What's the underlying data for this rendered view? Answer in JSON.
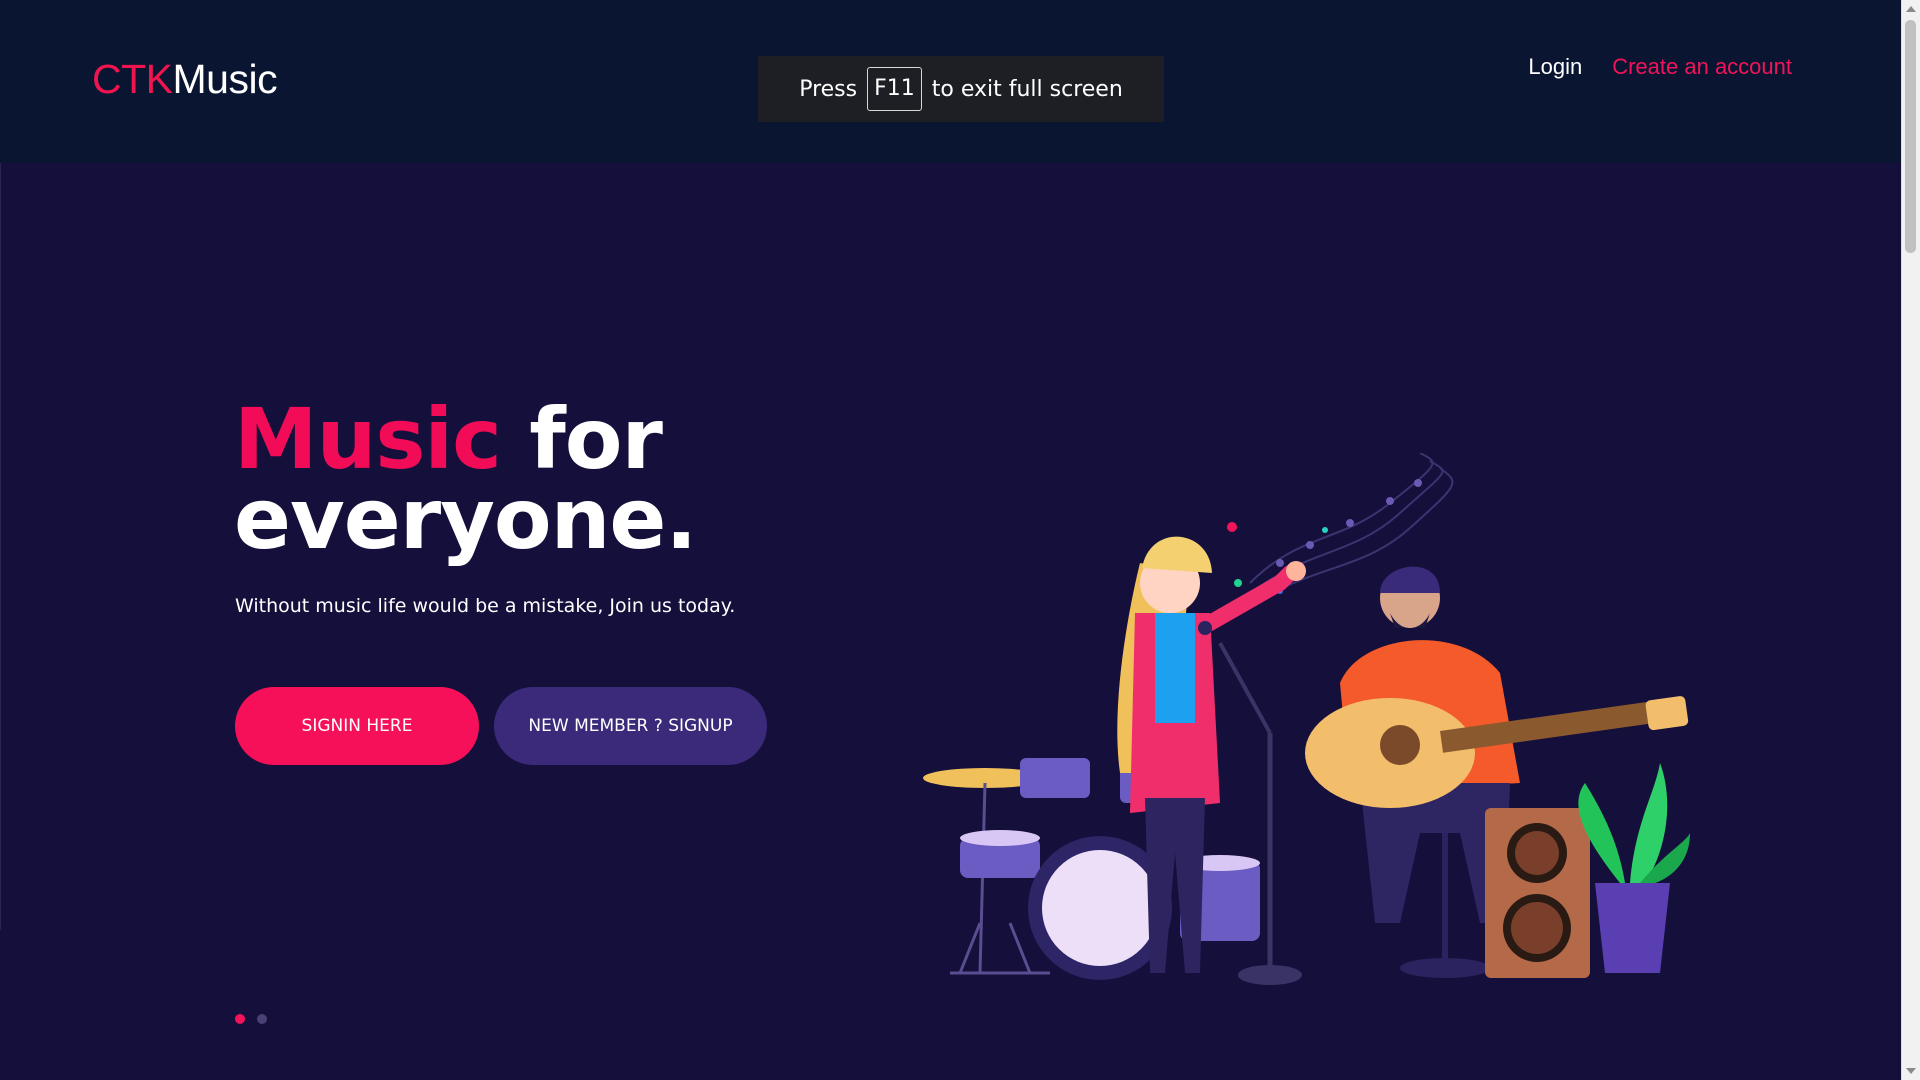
{
  "header": {
    "logo_prefix": "CTK",
    "logo_suffix": "Music",
    "nav": {
      "login": "Login",
      "create_account": "Create an account"
    }
  },
  "fullscreen_toast": {
    "before": "Press",
    "key": "F11",
    "after": "to exit full screen"
  },
  "hero": {
    "headline_accent": "Music",
    "headline_rest_1": "for",
    "headline_rest_2": "everyone.",
    "subtitle": "Without music life would be a mistake, Join us today.",
    "signin_label": "SIGNIN HERE",
    "signup_label": "NEW MEMBER ? SIGNUP",
    "carousel_active_index": 1,
    "carousel_total": 2
  },
  "colors": {
    "accent": "#f2145a",
    "background": "#150f3b",
    "header_bg": "#0a1631",
    "secondary_button": "#3b2a7a"
  }
}
